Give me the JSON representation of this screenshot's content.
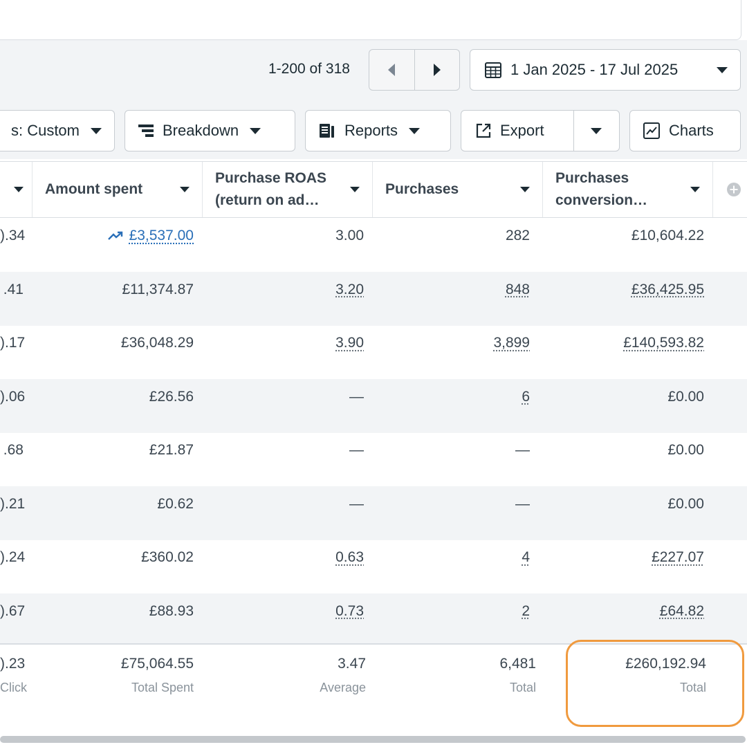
{
  "pagination": {
    "range_text": "1-200 of 318"
  },
  "date_range": {
    "label": "1 Jan 2025 - 17 Jul 2025",
    "icon": "calendar-icon"
  },
  "toolbar": {
    "columns_label": "s: Custom",
    "breakdown_label": "Breakdown",
    "reports_label": "Reports",
    "export_label": "Export",
    "charts_label": "Charts"
  },
  "table": {
    "headers": [
      {
        "label": ""
      },
      {
        "label": "Amount spent"
      },
      {
        "label": "Purchase ROAS (return on ad…"
      },
      {
        "label": "Purchases"
      },
      {
        "label": "Purchases conversion…"
      }
    ],
    "rows": [
      {
        "c0": ").34",
        "c1": "£3,537.00",
        "c2": "3.00",
        "c3": "282",
        "c4": "£10,604.22"
      },
      {
        "c0": ".41",
        "c1": "£11,374.87",
        "c2": "3.20",
        "c3": "848",
        "c4": "£36,425.95"
      },
      {
        "c0": ").17",
        "c1": "£36,048.29",
        "c2": "3.90",
        "c3": "3,899",
        "c4": "£140,593.82"
      },
      {
        "c0": ").06",
        "c1": "£26.56",
        "c2": "—",
        "c3": "6",
        "c4": "£0.00"
      },
      {
        "c0": ".68",
        "c1": "£21.87",
        "c2": "—",
        "c3": "—",
        "c4": "£0.00"
      },
      {
        "c0": ").21",
        "c1": "£0.62",
        "c2": "—",
        "c3": "—",
        "c4": "£0.00"
      },
      {
        "c0": ").24",
        "c1": "£360.02",
        "c2": "0.63",
        "c3": "4",
        "c4": "£227.07"
      },
      {
        "c0": ").67",
        "c1": "£88.93",
        "c2": "0.73",
        "c3": "2",
        "c4": "£64.82"
      }
    ],
    "totals": {
      "c0": {
        "value": ").23",
        "label": "Click"
      },
      "c1": {
        "value": "£75,064.55",
        "label": "Total Spent"
      },
      "c2": {
        "value": "3.47",
        "label": "Average"
      },
      "c3": {
        "value": "6,481",
        "label": "Total"
      },
      "c4": {
        "value": "£260,192.94",
        "label": "Total"
      }
    }
  },
  "colors": {
    "highlight": "#f09a3e",
    "link": "#2a6fb8"
  }
}
